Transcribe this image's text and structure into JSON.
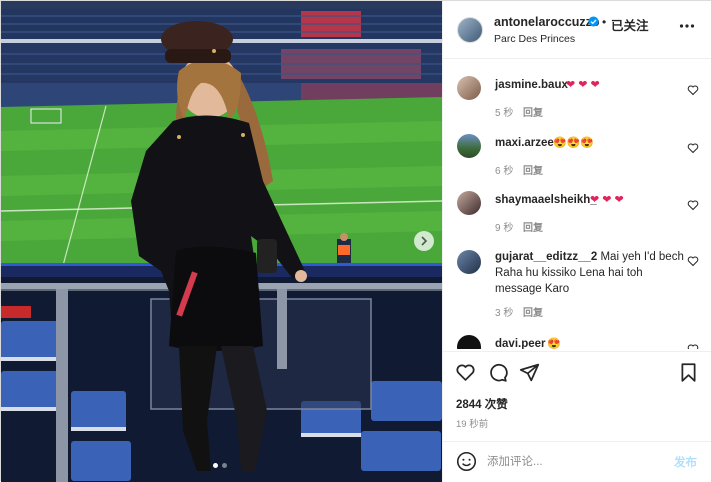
{
  "post": {
    "username": "antonelaroccuzzo",
    "follow_label": "已关注",
    "separator": "•",
    "location": "Parc Des Princes",
    "more_icon": "more-horizontal-icon",
    "verified_icon": "verified-badge-icon"
  },
  "media": {
    "carousel_total": 2,
    "carousel_active": 1,
    "next_icon": "chevron-right-icon"
  },
  "comments": [
    {
      "user": "jasmine.baux",
      "text": "",
      "emoji": "❤ ❤ ❤",
      "emoji_color": "#e0245e",
      "time": "5 秒",
      "reply": "回复"
    },
    {
      "user": "maxi.arzee",
      "text": "",
      "emoji": "😍😍😍",
      "emoji_color": "#e89c1c",
      "time": "6 秒",
      "reply": "回复"
    },
    {
      "user": "shaymaaelsheikh_",
      "text": "",
      "emoji": "❤ ❤ ❤",
      "emoji_color": "#e0245e",
      "time": "9 秒",
      "reply": "回复"
    },
    {
      "user": "gujarat__editzz__2",
      "text": "Mai yeh I'd bech Raha hu kissiko Lena hai toh message Karo",
      "emoji": "",
      "emoji_color": "",
      "time": "3 秒",
      "reply": "回复"
    },
    {
      "user": "davi.peer",
      "text": "",
      "emoji": "😍",
      "emoji_color": "#e89c1c",
      "time": "",
      "reply": ""
    }
  ],
  "actions": {
    "like_icon": "heart-icon",
    "comment_icon": "comment-icon",
    "share_icon": "share-icon",
    "save_icon": "bookmark-icon",
    "likes": "2844 次赞",
    "time": "19 秒前"
  },
  "composer": {
    "emoji_icon": "smiley-icon",
    "placeholder": "添加评论...",
    "post_label": "发布"
  },
  "colors": {
    "accent": "#0095f6",
    "post_disabled": "#b2dffc",
    "heart": "#e0245e"
  }
}
